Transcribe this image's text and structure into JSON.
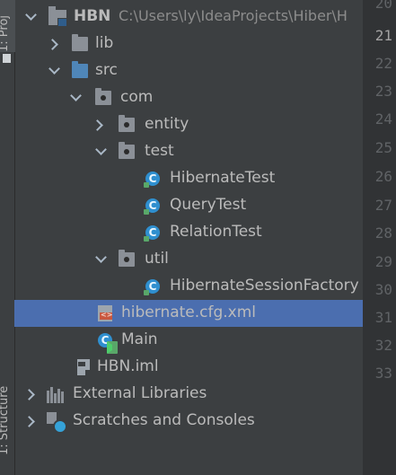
{
  "side_tabs": {
    "project": "1: Proj",
    "structure": "1: Structure"
  },
  "tree": {
    "project": {
      "name": "HBN",
      "path": "C:\\Users\\ly\\IdeaProjects\\Hiber\\H"
    },
    "lib": "lib",
    "src": "src",
    "com": "com",
    "entity": "entity",
    "test": "test",
    "test_classes": [
      "HibernateTest",
      "QueryTest",
      "RelationTest"
    ],
    "util": "util",
    "util_class": "HibernateSessionFactory",
    "config_file": "hibernate.cfg.xml",
    "main_class": "Main",
    "module_file": "HBN.iml",
    "external": "External Libraries",
    "scratches": "Scratches and Consoles"
  },
  "class_icon_letter": "C",
  "line_numbers": [
    "20",
    "21",
    "22",
    "23",
    "24",
    "25",
    "26",
    "27",
    "28",
    "29",
    "30",
    "31",
    "32",
    "33"
  ],
  "colors": {
    "selection": "#4b6eaf",
    "background": "#3c3f41",
    "text": "#bbbbbb"
  }
}
